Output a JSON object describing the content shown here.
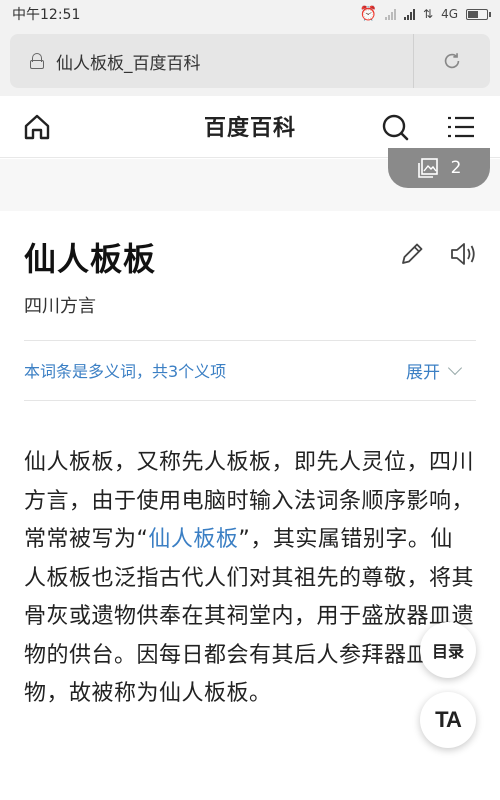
{
  "status_bar": {
    "time": "中午12:51",
    "network": "4G",
    "battery_level": 0.6
  },
  "browser": {
    "page_title": "仙人板板_百度百科",
    "reload_icon": "refresh-icon"
  },
  "header": {
    "site_title": "百度百科",
    "home_icon": "home-icon",
    "search_icon": "search-icon",
    "menu_icon": "menu-icon"
  },
  "gallery": {
    "count": "2"
  },
  "entry": {
    "title": "仙人板板",
    "subtitle": "四川方言",
    "polysemy_notice": "本词条是多义词，共3个义项",
    "expand_label": "展开"
  },
  "content": {
    "part1": "仙人板板，又称先人板板，即先人灵位，四川方言，由于使用电脑时输入法词条顺序影响，常常被写为“",
    "link_text": "仙人板板",
    "part2": "”，其实属错别字。仙人板板也泛指古代人们对其祖先的尊敬，将其骨灰或遗物供奉在其祠堂内，用于盛放器皿遗物的供台。因每日都会有其后人参拜器皿遗物，故被称为仙人板板。"
  },
  "fabs": {
    "toc_label": "目录",
    "font_label": "TA"
  }
}
